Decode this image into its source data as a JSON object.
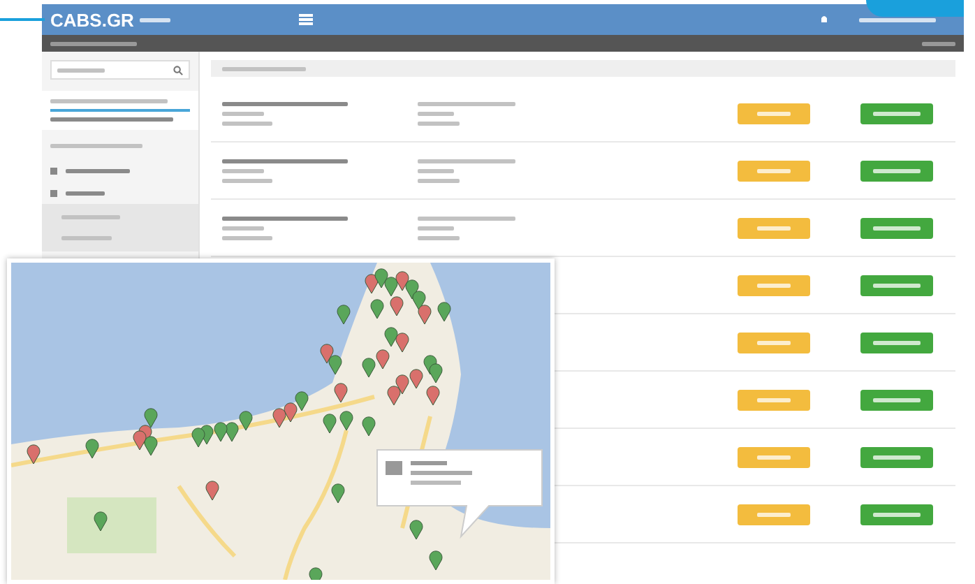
{
  "header": {
    "logo": "CABS.GR"
  },
  "sidebar": {
    "quota": {
      "level": 1
    }
  }
}
